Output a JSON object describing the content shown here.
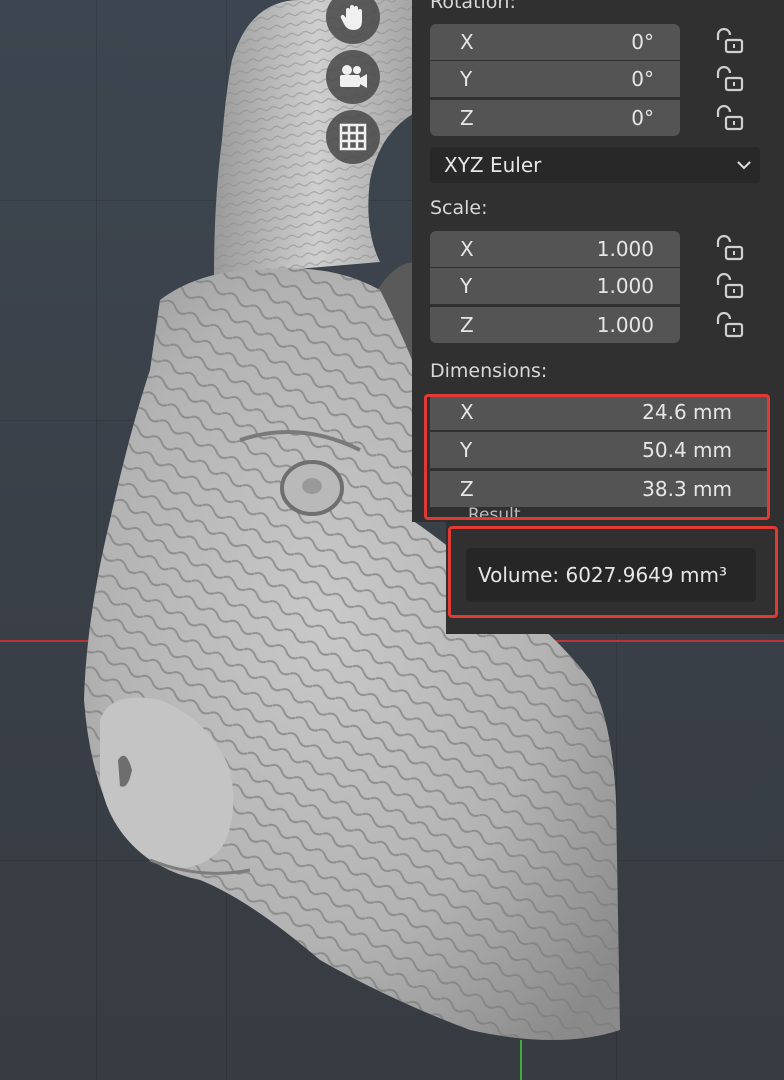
{
  "viewport": {
    "navigation": [
      {
        "icon": "hand-icon",
        "label": "Move view"
      },
      {
        "icon": "camera-icon",
        "label": "Toggle camera view"
      },
      {
        "icon": "grid-icon",
        "label": "Toggle orthographic"
      }
    ]
  },
  "transform": {
    "rotation": {
      "label": "Rotation:",
      "rows": [
        {
          "axis": "X",
          "value": "0°"
        },
        {
          "axis": "Y",
          "value": "0°"
        },
        {
          "axis": "Z",
          "value": "0°"
        }
      ],
      "mode": "XYZ Euler"
    },
    "scale": {
      "label": "Scale:",
      "rows": [
        {
          "axis": "X",
          "value": "1.000"
        },
        {
          "axis": "Y",
          "value": "1.000"
        },
        {
          "axis": "Z",
          "value": "1.000"
        }
      ]
    },
    "dimensions": {
      "label": "Dimensions:",
      "rows": [
        {
          "axis": "X",
          "value": "24.6 mm"
        },
        {
          "axis": "Y",
          "value": "50.4 mm"
        },
        {
          "axis": "Z",
          "value": "38.3 mm"
        }
      ]
    }
  },
  "result": {
    "label": "Result",
    "volume": "Volume: 6027.9649 mm³"
  },
  "colors": {
    "highlight": "#e03a34",
    "x_axis": "#b8343a",
    "y_axis": "#3fae3f"
  }
}
